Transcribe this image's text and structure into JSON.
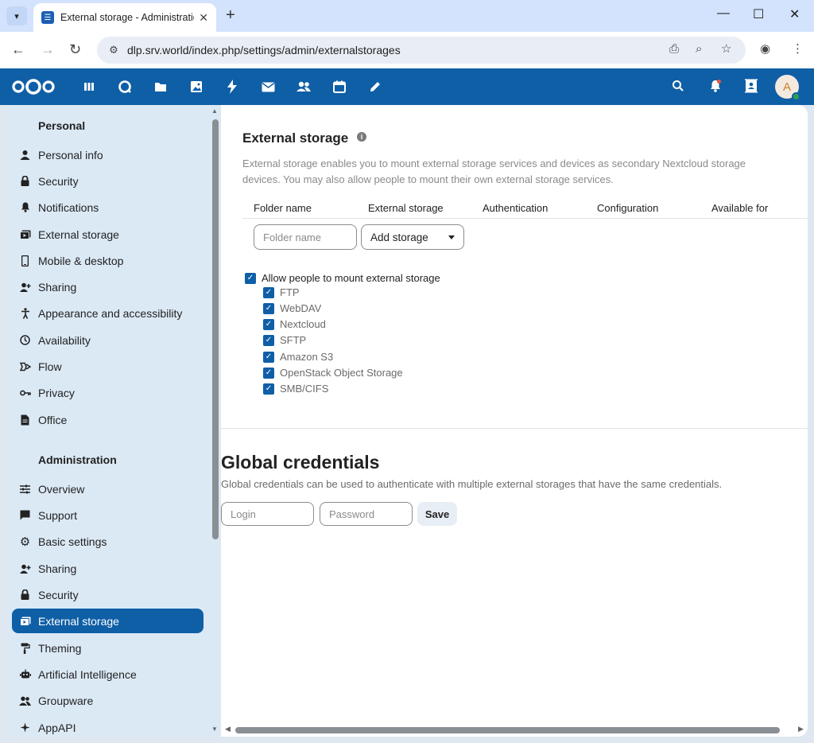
{
  "browser": {
    "tab_title": "External storage - Administration",
    "url": "dlp.srv.world/index.php/settings/admin/externalstorages"
  },
  "header": {
    "apps": [
      "dashboard",
      "talk",
      "files",
      "photos",
      "activity",
      "mail",
      "contacts",
      "calendar",
      "notes"
    ],
    "avatar_initial": "A",
    "accent_color": "#0f5fa6"
  },
  "sidebar": {
    "personal_heading": "Personal",
    "personal_items": [
      {
        "label": "Personal info",
        "icon": "person-icon"
      },
      {
        "label": "Security",
        "icon": "lock-icon"
      },
      {
        "label": "Notifications",
        "icon": "bell-icon"
      },
      {
        "label": "External storage",
        "icon": "external-storage-icon"
      },
      {
        "label": "Mobile & desktop",
        "icon": "phone-icon"
      },
      {
        "label": "Sharing",
        "icon": "share-icon"
      },
      {
        "label": "Appearance and accessibility",
        "icon": "accessibility-icon"
      },
      {
        "label": "Availability",
        "icon": "clock-icon"
      },
      {
        "label": "Flow",
        "icon": "flow-icon"
      },
      {
        "label": "Privacy",
        "icon": "key-icon"
      },
      {
        "label": "Office",
        "icon": "document-icon"
      }
    ],
    "admin_heading": "Administration",
    "admin_items": [
      {
        "label": "Overview",
        "icon": "tune-icon"
      },
      {
        "label": "Support",
        "icon": "chat-icon"
      },
      {
        "label": "Basic settings",
        "icon": "gear-icon"
      },
      {
        "label": "Sharing",
        "icon": "share-icon"
      },
      {
        "label": "Security",
        "icon": "lock-icon"
      },
      {
        "label": "External storage",
        "icon": "external-storage-icon",
        "active": true
      },
      {
        "label": "Theming",
        "icon": "paint-roller-icon"
      },
      {
        "label": "Artificial Intelligence",
        "icon": "robot-icon"
      },
      {
        "label": "Groupware",
        "icon": "group-icon"
      },
      {
        "label": "AppAPI",
        "icon": "api-icon"
      }
    ]
  },
  "main": {
    "title": "External storage",
    "description": "External storage enables you to mount external storage services and devices as secondary Nextcloud storage devices. You may also allow people to mount their own external storage services.",
    "columns": [
      "Folder name",
      "External storage",
      "Authentication",
      "Configuration",
      "Available for"
    ],
    "folder_placeholder": "Folder name",
    "add_storage_label": "Add storage",
    "allow_mount_label": "Allow people to mount external storage",
    "backends": [
      "FTP",
      "WebDAV",
      "Nextcloud",
      "SFTP",
      "Amazon S3",
      "OpenStack Object Storage",
      "SMB/CIFS"
    ]
  },
  "global_credentials": {
    "title": "Global credentials",
    "description": "Global credentials can be used to authenticate with multiple external storages that have the same credentials.",
    "login_placeholder": "Login",
    "password_placeholder": "Password",
    "save_label": "Save"
  }
}
